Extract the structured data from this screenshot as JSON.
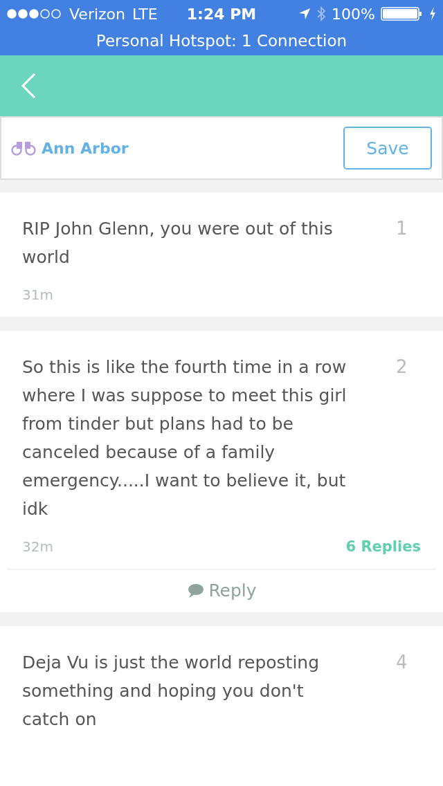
{
  "status_bar": {
    "carrier": "Verizon",
    "network": "LTE",
    "time": "1:24 PM",
    "battery": "100%",
    "hotspot": "Personal Hotspot: 1 Connection"
  },
  "location_bar": {
    "location": "Ann Arbor",
    "save_button": "Save"
  },
  "posts": [
    {
      "text": "RIP John Glenn, you were out of this world",
      "score": "1",
      "time": "31m"
    },
    {
      "text": "So this is like the fourth time in a row where I was suppose to meet this girl from tinder but plans had to be canceled because of a family emergency.....I want to believe it, but idk",
      "score": "2",
      "time": "32m",
      "replies": "6 Replies",
      "reply_button": "Reply"
    },
    {
      "text": "Deja Vu is just the world reposting something and hoping you don't catch on",
      "score": "4"
    }
  ]
}
